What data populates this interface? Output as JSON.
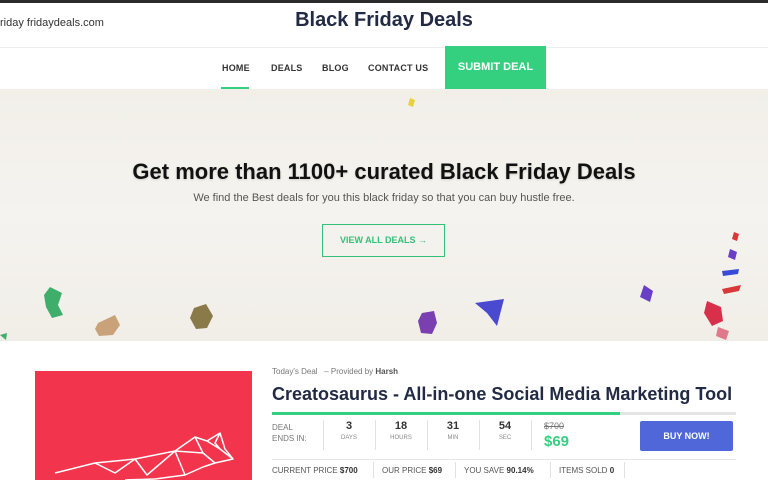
{
  "header": {
    "domain": "riday fridaydeals.com",
    "title": "Black Friday Deals"
  },
  "nav": {
    "items": [
      {
        "label": "HOME"
      },
      {
        "label": "DEALS"
      },
      {
        "label": "BLOG"
      },
      {
        "label": "CONTACT US"
      }
    ],
    "submit_label": "SUBMIT DEAL"
  },
  "hero": {
    "title": "Get more than 1100+ curated Black Friday Deals",
    "subtitle": "We find the Best deals for you this black friday so that you can buy hustle free.",
    "button_label": "VIEW ALL DEALS →"
  },
  "deal": {
    "today_label": "Today's Deal",
    "provided_prefix": "– Provided by",
    "provider": "Harsh",
    "title": "Creatosaurus - All-in-one Social Media Marketing Tool",
    "progress": 0.75,
    "ends_label_1": "DEAL",
    "ends_label_2": "ENDS IN:",
    "countdown": [
      {
        "value": "3",
        "unit": "DAYS"
      },
      {
        "value": "18",
        "unit": "HOURS"
      },
      {
        "value": "31",
        "unit": "MIN"
      },
      {
        "value": "54",
        "unit": "SEC"
      }
    ],
    "old_price": "$700",
    "new_price": "$69",
    "buy_label": "BUY NOW!",
    "stats": {
      "current_label": "CURRENT PRICE",
      "current_value": "$700",
      "our_label": "OUR PRICE",
      "our_value": "$69",
      "save_label": "YOU SAVE",
      "save_value": "90.14%",
      "sold_label": "ITEMS SOLD",
      "sold_value": "0"
    }
  },
  "colors": {
    "accent": "#35d07f",
    "buy": "#4f67d8",
    "deal_image_bg": "#f2354d",
    "title": "#222a44"
  }
}
